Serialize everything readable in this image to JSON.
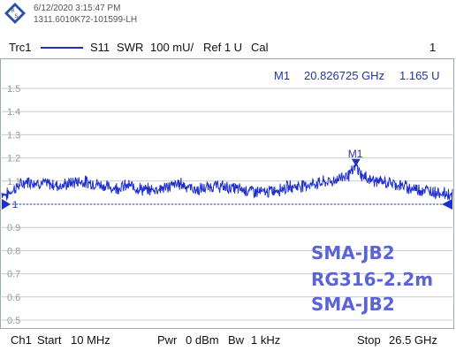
{
  "instrument": {
    "timestamp": "6/12/2020 3:15:47 PM",
    "device_id": "1311.6010K72-101599-LH"
  },
  "trace": {
    "name": "Trc1",
    "measurement": "S11",
    "format": "SWR",
    "scale": "100 mU/",
    "reference": "Ref 1 U",
    "calibration": "Cal",
    "diagram_number": "1",
    "color": "#1f2fcf"
  },
  "marker": {
    "name": "M1",
    "frequency": "20.826725 GHz",
    "value": "1.165 U",
    "color": "#2233aa"
  },
  "annotation": {
    "lines": [
      "SMA-JB2",
      "RG316-2.2m",
      "SMA-JB2"
    ],
    "color": "#5b63d6"
  },
  "footer": {
    "channel": "Ch1",
    "start_label": "Start",
    "start_value": "10 MHz",
    "power_label": "Pwr",
    "power_value": "0 dBm",
    "bandwidth_label": "Bw",
    "bandwidth_value": "1 kHz",
    "stop_label": "Stop",
    "stop_value": "26.5 GHz"
  },
  "chart_data": {
    "type": "line",
    "title": "",
    "xlabel": "",
    "ylabel": "",
    "xlim_ghz": [
      0.01,
      26.5
    ],
    "ylim": [
      0.5,
      1.5
    ],
    "y_ticks": [
      0.5,
      0.6,
      0.7,
      0.8,
      0.9,
      1.0,
      1.1,
      1.2,
      1.3,
      1.4,
      1.5
    ],
    "y_tick_labels": [
      "0.5",
      "0.6",
      "0.7",
      "0.8",
      "0.9",
      "",
      "1.1",
      "1.2",
      "1.3",
      "1.4",
      "1.5"
    ],
    "reference_value": 1.0,
    "reference_label": "1",
    "grid": true,
    "series": [
      {
        "x_ghz": [
          0.01,
          0.3,
          0.8,
          1.5,
          2.5,
          3.5,
          4.5,
          5.5,
          6.5,
          7.5,
          8.5,
          9.5,
          10.5,
          11.5,
          12.5,
          13.5,
          14.5,
          15.5,
          16.5,
          17.5,
          18.5,
          19.5,
          20.0,
          20.5,
          20.83,
          21.2,
          22.0,
          23.0,
          24.0,
          25.0,
          25.8,
          26.5
        ],
        "values": [
          1.05,
          1.04,
          1.07,
          1.1,
          1.09,
          1.08,
          1.1,
          1.09,
          1.07,
          1.08,
          1.06,
          1.07,
          1.09,
          1.06,
          1.08,
          1.07,
          1.06,
          1.05,
          1.07,
          1.08,
          1.09,
          1.1,
          1.12,
          1.13,
          1.165,
          1.12,
          1.1,
          1.09,
          1.07,
          1.06,
          1.05,
          1.04
        ]
      }
    ]
  }
}
